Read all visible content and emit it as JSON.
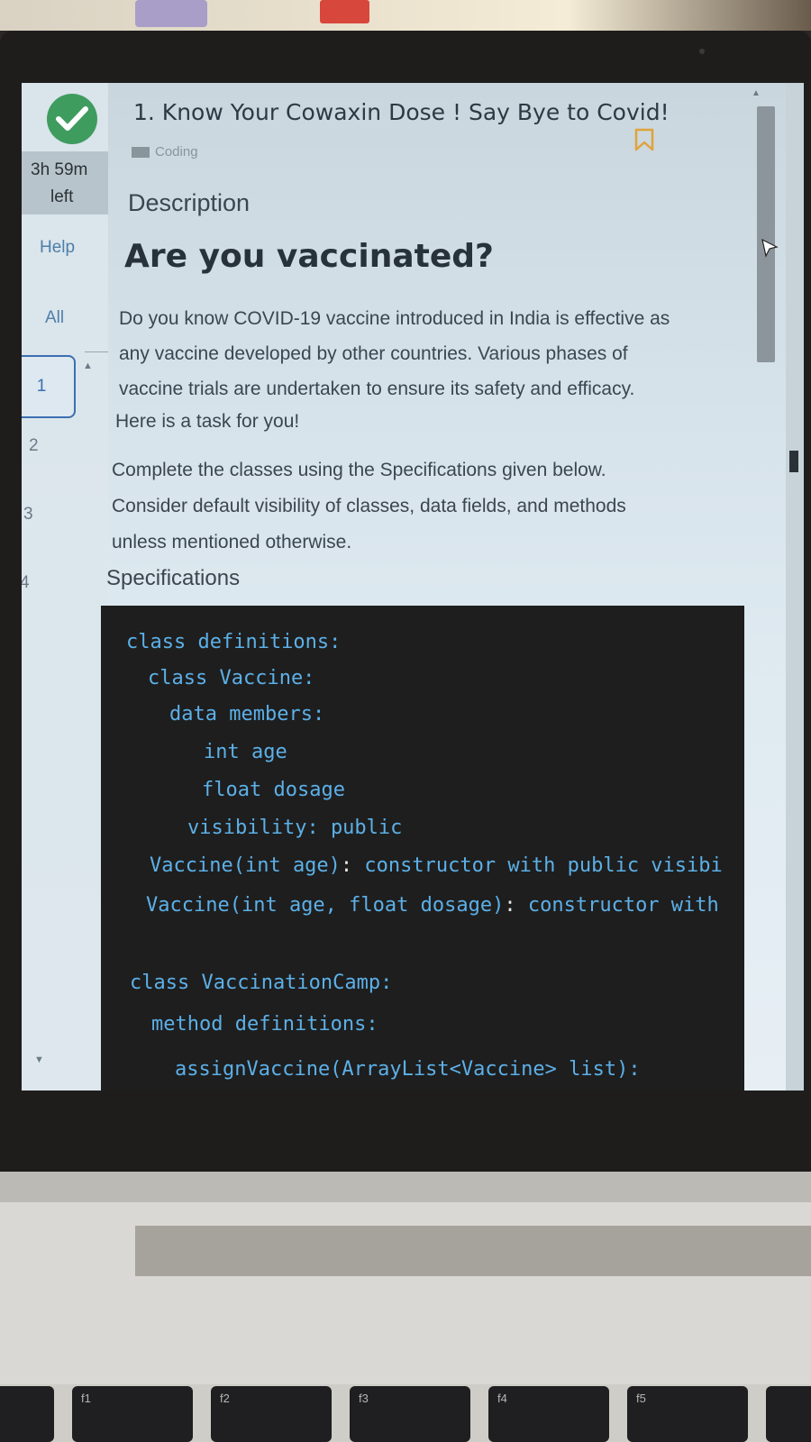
{
  "question": {
    "title": "1. Know Your Cowaxin Dose ! Say Bye to Covid!",
    "tag": "Coding",
    "section_label": "Description",
    "heading": "Are you vaccinated?",
    "paragraph_lines": [
      "Do you know COVID-19 vaccine introduced in India is effective as",
      "any vaccine developed by other countries. Various phases of",
      "vaccine trials are undertaken to ensure its safety and efficacy."
    ],
    "task_line": "Here is a task for you!",
    "instruction_lines": [
      "Complete the classes using the Specifications given below.",
      "Consider default visibility of classes, data fields, and methods",
      "unless mentioned otherwise."
    ],
    "spec_label": "Specifications"
  },
  "sidebar": {
    "timer_line1": "3h 59m",
    "timer_line2": "left",
    "help_label": "Help",
    "all_label": "All",
    "questions": [
      "1",
      "2",
      "3",
      "4"
    ],
    "active_question": "1"
  },
  "code": {
    "class_definitions": "class definitions:",
    "class_vaccine": "class Vaccine:",
    "data_members": "data members:",
    "field_age": "int age",
    "field_dosage": "float dosage",
    "visibility": "visibility: public",
    "ctor1_sig": "Vaccine(int age)",
    "ctor1_desc": "constructor with public visibi",
    "ctor2_sig": "Vaccine(int age, float dosage)",
    "ctor2_desc": "constructor with",
    "class_camp": "class VaccinationCamp:",
    "method_defs": "method definitions:",
    "assign_sig": "assignVaccine(ArrayList<Vaccine> list):"
  },
  "keyboard": {
    "f1": "f1",
    "f2": "f2",
    "f3": "f3",
    "f4": "f4",
    "f5": "f5"
  },
  "icons": {
    "status": "check-icon",
    "bookmark": "bookmark-icon",
    "cursor": "mouse-pointer-icon"
  },
  "colors": {
    "accent_blue": "#3c6fb0",
    "success_green": "#3f9c5f",
    "code_bg": "#1e1e1e",
    "code_text": "#5cb0e8"
  }
}
